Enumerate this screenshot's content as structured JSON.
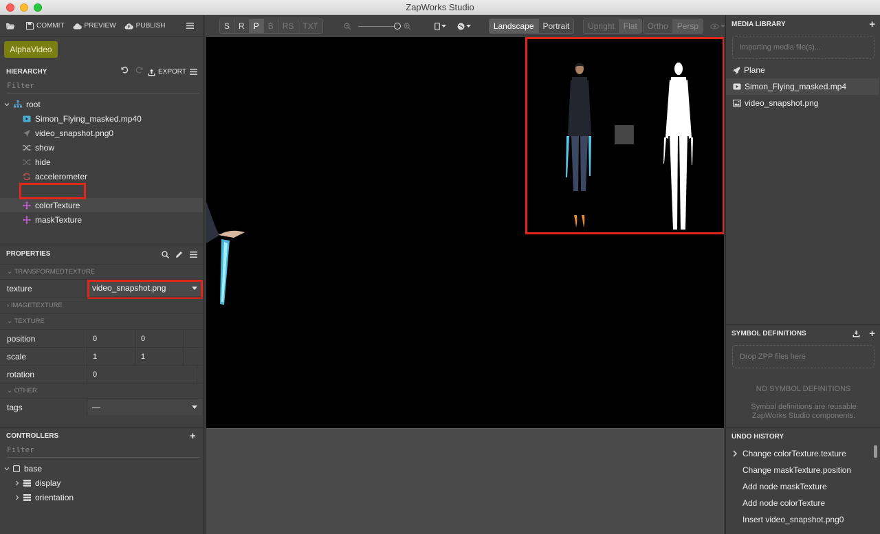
{
  "window": {
    "title": "ZapWorks Studio"
  },
  "topbar": {
    "commit": "COMMIT",
    "preview": "PREVIEW",
    "publish": "PUBLISH"
  },
  "project": {
    "name": "AlphaVideo"
  },
  "hierarchy": {
    "title": "HIERARCHY",
    "export": "EXPORT",
    "filter_placeholder": "Filter",
    "root": "root",
    "items": [
      {
        "label": "Simon_Flying_masked.mp40",
        "icon": "video-icon"
      },
      {
        "label": "video_snapshot.png0",
        "icon": "plane-icon"
      },
      {
        "label": "show",
        "icon": "shuffle-icon"
      },
      {
        "label": "hide",
        "icon": "shuffle-icon"
      },
      {
        "label": "accelerometer",
        "icon": "refresh-icon"
      },
      {
        "label": "colorTexture",
        "icon": "transform-icon"
      },
      {
        "label": "maskTexture",
        "icon": "transform-icon"
      }
    ]
  },
  "properties": {
    "title": "PROPERTIES",
    "sections": {
      "transformed": "TRANSFORMEDTEXTURE",
      "image": "IMAGETEXTURE",
      "texture": "TEXTURE",
      "other": "OTHER"
    },
    "texture_label": "texture",
    "texture_value": "video_snapshot.png",
    "position_label": "position",
    "position_x": "0",
    "position_y": "0",
    "scale_label": "scale",
    "scale_x": "1",
    "scale_y": "1",
    "rotation_label": "rotation",
    "rotation_value": "0",
    "tags_label": "tags",
    "tags_value": "—"
  },
  "controllers": {
    "title": "CONTROLLERS",
    "filter_placeholder": "Filter",
    "base": "base",
    "items": [
      "display",
      "orientation"
    ]
  },
  "toolbar": {
    "modes": [
      "S",
      "R",
      "P",
      "B",
      "RS",
      "TXT"
    ],
    "orientation": [
      "Landscape",
      "Portrait"
    ],
    "view": [
      "Upright",
      "Flat"
    ],
    "projection": [
      "Ortho",
      "Persp"
    ]
  },
  "media_library": {
    "title": "MEDIA LIBRARY",
    "importing": "Importing media file(s)...",
    "items": [
      {
        "label": "Plane",
        "icon": "rocket-icon"
      },
      {
        "label": "Simon_Flying_masked.mp4",
        "icon": "video-icon"
      },
      {
        "label": "video_snapshot.png",
        "icon": "image-icon"
      }
    ]
  },
  "symbols": {
    "title": "SYMBOL DEFINITIONS",
    "drop": "Drop ZPP files here",
    "empty": "NO SYMBOL DEFINITIONS",
    "desc": "Symbol definitions are reusable ZapWorks Studio components."
  },
  "undo": {
    "title": "UNDO HISTORY",
    "items": [
      "Change colorTexture.texture",
      "Change maskTexture.position",
      "Add node maskTexture",
      "Add node colorTexture",
      "Insert video_snapshot.png0"
    ]
  }
}
